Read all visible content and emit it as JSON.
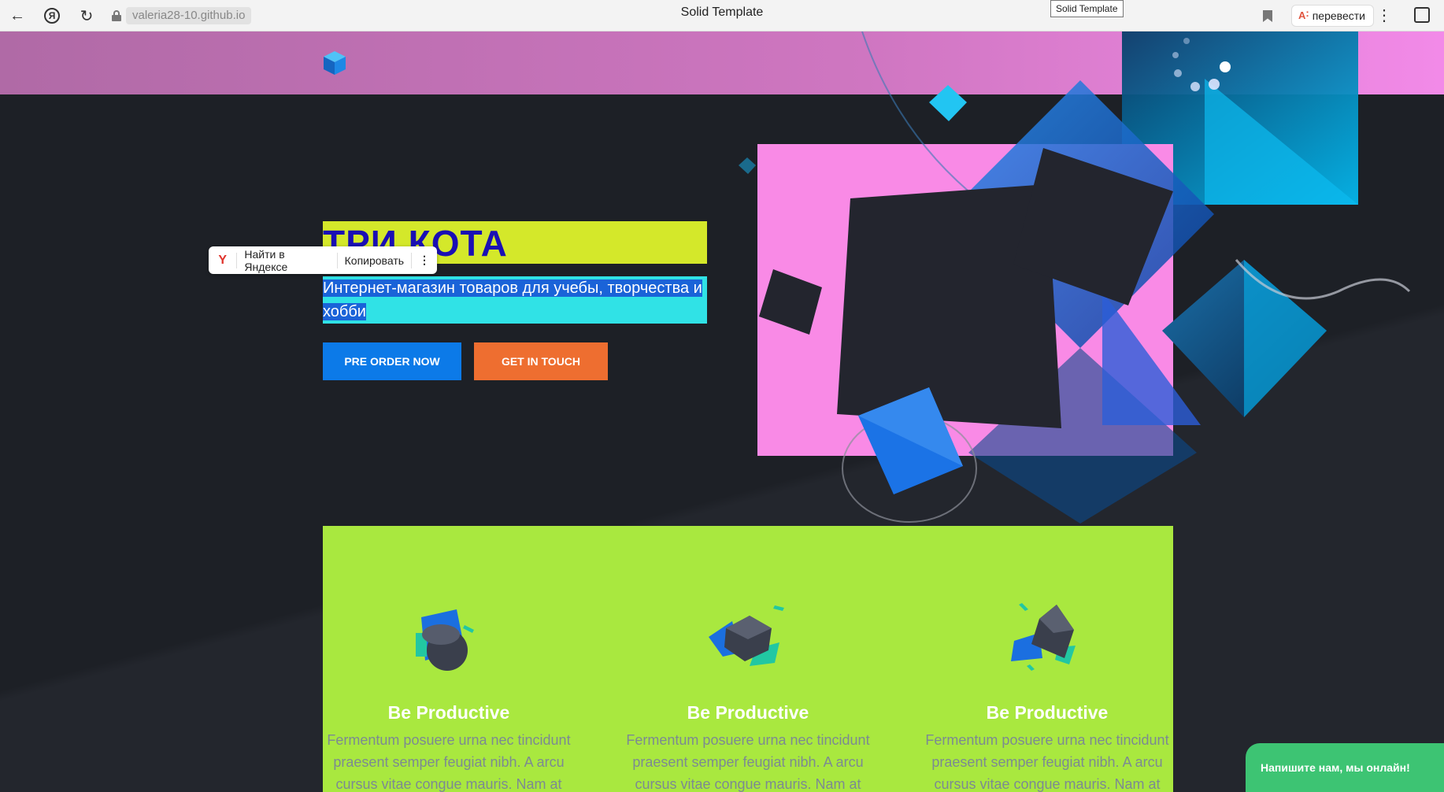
{
  "browser": {
    "url": "valeria28-10.github.io",
    "page_title": "Solid Template",
    "tooltip": "Solid Template",
    "translate_label": "перевести",
    "icons": [
      "back-icon",
      "yandex-icon",
      "reload-icon",
      "lock-icon",
      "bookmark-icon",
      "translate-icon",
      "menu-icon",
      "extensions-icon"
    ]
  },
  "hero": {
    "title": "ТРИ КОТА",
    "subtitle": "Интернет-магазин товаров для учебы, творчества и хобби",
    "primary_button": "PRE ORDER NOW",
    "secondary_button": "GET IN TOUCH"
  },
  "selection_menu": {
    "search_label": "Найти в Яндексе",
    "copy_label": "Копировать"
  },
  "features": [
    {
      "title": "Be Productive",
      "text": "Fermentum posuere urna nec tincidunt praesent semper feugiat nibh. A arcu cursus vitae congue mauris. Nam at",
      "icon": "cylinder-icon"
    },
    {
      "title": "Be Productive",
      "text": "Fermentum posuere urna nec tincidunt praesent semper feugiat nibh. A arcu cursus vitae congue mauris. Nam at",
      "icon": "cube-icon"
    },
    {
      "title": "Be Productive",
      "text": "Fermentum posuere urna nec tincidunt praesent semper feugiat nibh. A arcu cursus vitae congue mauris. Nam at",
      "icon": "pyramid-icon"
    }
  ],
  "chat_widget": {
    "label": "Напишите нам, мы онлайн!"
  },
  "colors": {
    "title_bg": "#d4e82a",
    "title_text": "#1a0fb4",
    "subtitle_bg": "#30e2e6",
    "primary_button": "#0c7ae8",
    "secondary_button": "#ee6e30",
    "features_bg": "#a9e83f",
    "chat_bg": "#3dc473"
  }
}
